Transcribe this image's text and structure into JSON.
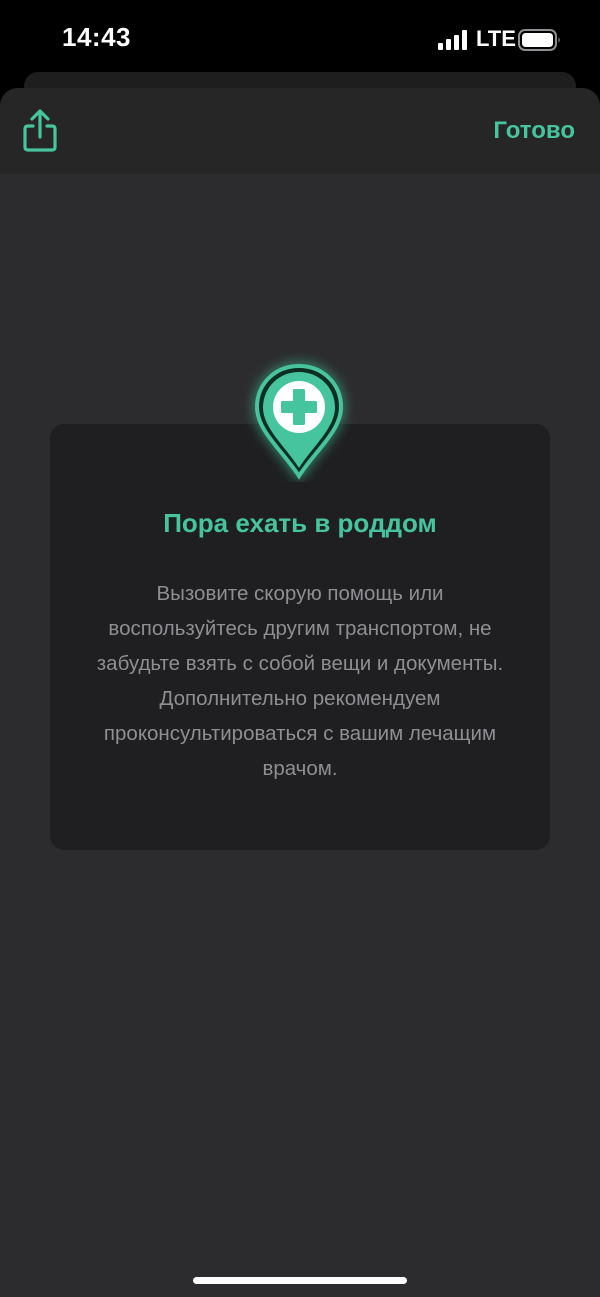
{
  "status_bar": {
    "time": "14:43",
    "network": "LTE",
    "signal_icon": "signal-bars-icon",
    "battery_icon": "battery-icon"
  },
  "nav": {
    "share_icon": "share-icon",
    "done_label": "Готово"
  },
  "card": {
    "icon": "medical-location-pin-icon",
    "title": "Пора ехать в роддом",
    "text": "Вызовите скорую помощь или воспользуйтесь другим транспортом, не забудьте взять с собой вещи и документы. Дополнительно рекомендуем проконсультироваться с вашим лечащим врачом."
  },
  "colors": {
    "accent": "#46c49d",
    "background": "#2c2c2e",
    "card": "#1f1f21",
    "body_text": "#8e8e93"
  }
}
